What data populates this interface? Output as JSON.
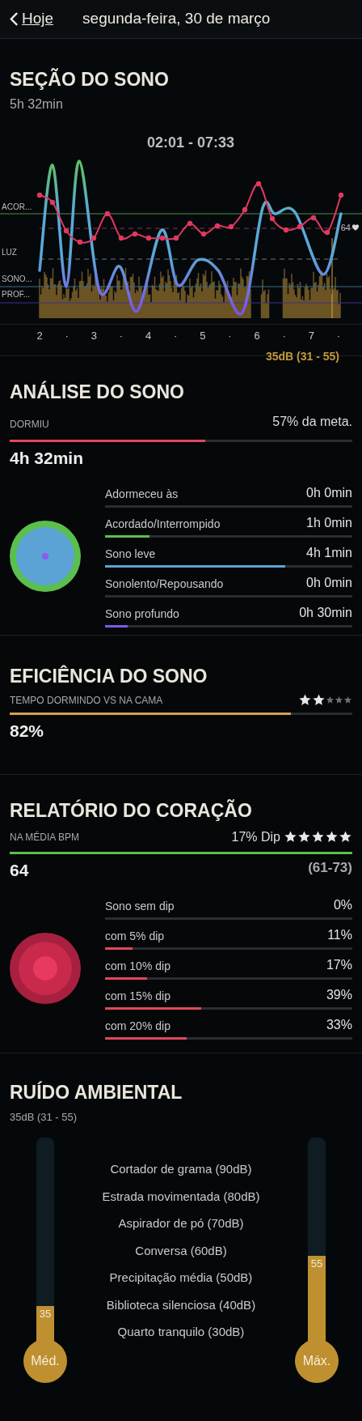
{
  "header": {
    "back_label": "Hoje",
    "title": "segunda-feira, 30 de março"
  },
  "sleep_session": {
    "title": "SEÇÃO DO SONO",
    "duration": "5h 32min",
    "time_range": "02:01 - 07:33",
    "stage_labels": [
      "ACOR...",
      "LUZ",
      "SONO...",
      "PROF..."
    ],
    "x_labels": [
      "2",
      "·",
      "3",
      "·",
      "4",
      "·",
      "5",
      "·",
      "6",
      "·",
      "7",
      "·"
    ],
    "heart_value": "64",
    "noise_summary": "35dB (31 - 55)"
  },
  "analysis": {
    "title": "ANÁLISE DO SONO",
    "slept_label": "DORMIU",
    "goal_text": "57% da meta.",
    "level": 0.57,
    "slept_value": "4h 32min",
    "stages": [
      {
        "label": "Adormeceu às",
        "value": "0h 0min"
      },
      {
        "label": "Acordado/Interrompido",
        "value": "1h 0min",
        "level": 0.18,
        "color": "#5bbf4e"
      },
      {
        "label": "Sono leve",
        "value": "4h 1min",
        "level": 0.73,
        "color": "#5aa3d4"
      },
      {
        "label": "Sonolento/Repousando",
        "value": "0h 0min"
      },
      {
        "label": "Sono profundo",
        "value": "0h 30min",
        "level": 0.09,
        "color": "#7b5be8"
      }
    ]
  },
  "efficiency": {
    "title": "EFICIÊNCIA DO SONO",
    "subtitle": "TEMPO DORMINDO VS NA CAMA",
    "stars": 2,
    "level": 0.82,
    "value": "82%"
  },
  "heart": {
    "title": "RELATÓRIO DO CORAÇÃO",
    "subtitle": "NA MÉDIA BPM",
    "dip_text": "17% Dip",
    "stars": 5,
    "level": 1,
    "value": "64",
    "range": "(61-73)",
    "dips": [
      {
        "label": "Sono sem dip",
        "value": "0%"
      },
      {
        "label": "com 5% dip",
        "value": "11%",
        "level": 0.11
      },
      {
        "label": "com 10% dip",
        "value": "17%",
        "level": 0.17
      },
      {
        "label": "com 15% dip",
        "value": "39%",
        "level": 0.39
      },
      {
        "label": "com 20% dip",
        "value": "33%",
        "level": 0.33
      }
    ]
  },
  "noise": {
    "title": "RUÍDO AMBIENTAL",
    "summary": "35dB (31 - 55)",
    "references": [
      "Cortador de grama (90dB)",
      "Estrada movimentada (80dB)",
      "Aspirador de pó (70dB)",
      "Conversa (60dB)",
      "Precipitação média (50dB)",
      "Biblioteca silenciosa (40dB)",
      "Quarto tranquilo (30dB)"
    ],
    "gauges": [
      {
        "label": "Méd.",
        "reading": "35",
        "level": 0.2
      },
      {
        "label": "Máx.",
        "reading": "55",
        "level": 0.44
      }
    ]
  }
}
